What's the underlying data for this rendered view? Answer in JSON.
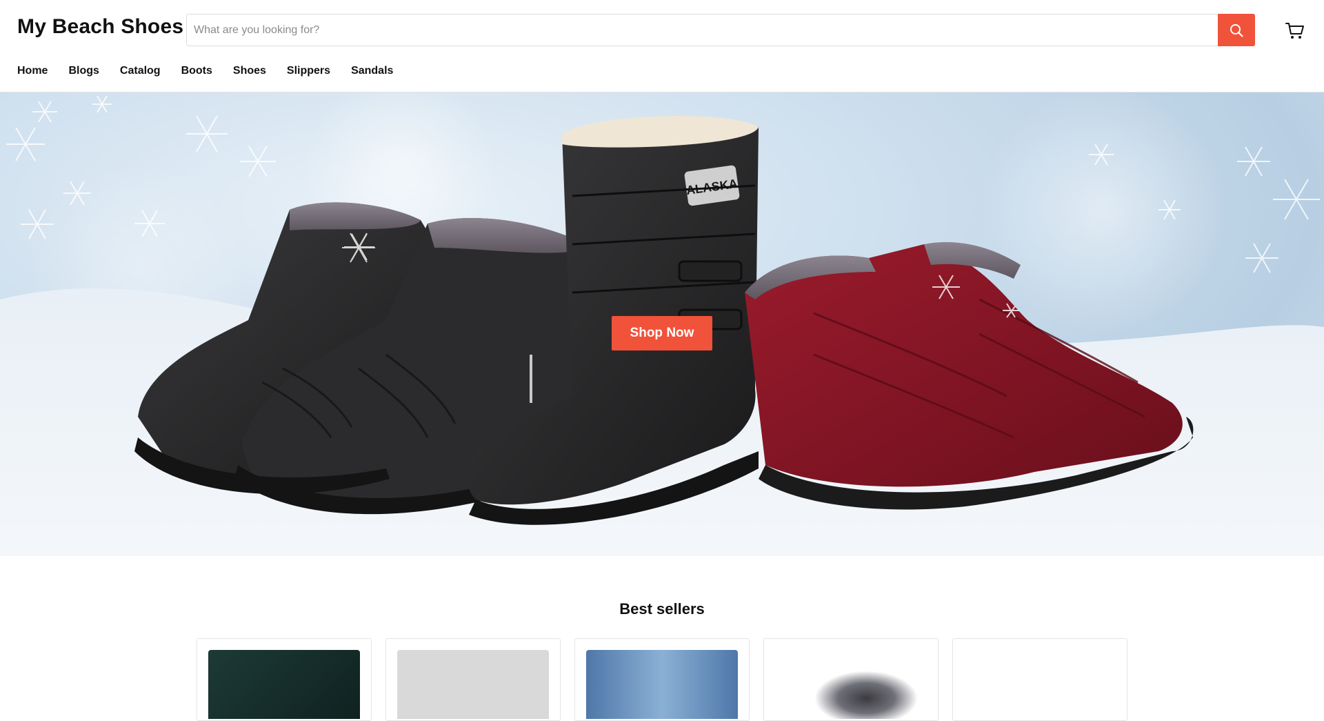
{
  "header": {
    "brand": "My Beach Shoes",
    "search_placeholder": "What are you looking for?",
    "search_value": "",
    "accent_color": "#f1523a"
  },
  "nav": {
    "items": [
      "Home",
      "Blogs",
      "Catalog",
      "Boots",
      "Shoes",
      "Slippers",
      "Sandals"
    ]
  },
  "hero": {
    "cta_label": "Shop Now",
    "boot_patch_text": "ALASKA"
  },
  "best_sellers": {
    "title": "Best sellers",
    "product_count": 5
  },
  "icons": {
    "search": "search-icon",
    "cart": "cart-icon"
  }
}
